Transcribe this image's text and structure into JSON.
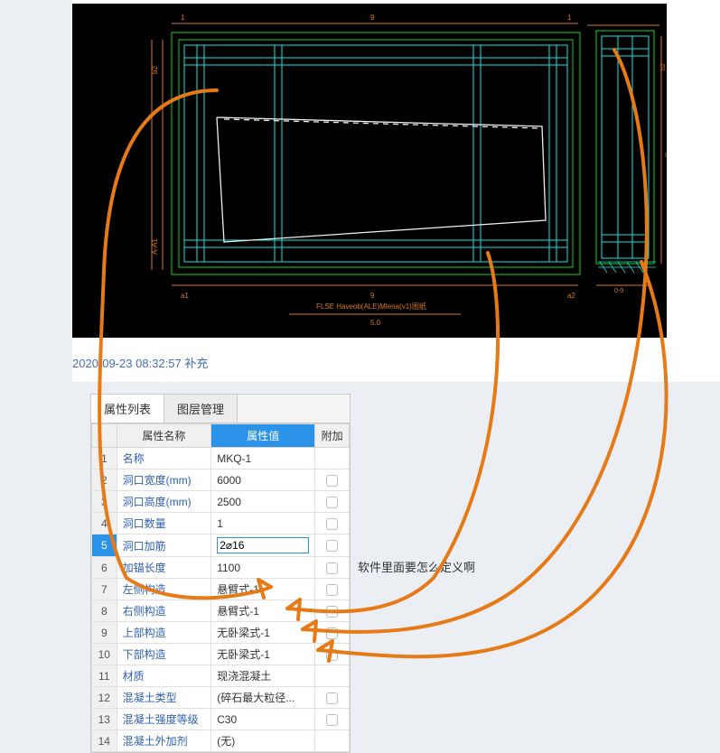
{
  "timestamp_line": "2020-09-23 08:32:57 补充",
  "tabs": {
    "active": "属性列表",
    "inactive": "图层管理"
  },
  "headers": {
    "name": "属性名称",
    "value": "属性值",
    "extra": "附加"
  },
  "side_note": "软件里面要怎么定义啊",
  "rows": [
    {
      "n": "1",
      "name": "名称",
      "val": "MKQ-1",
      "link": true,
      "chk": false
    },
    {
      "n": "2",
      "name": "洞口宽度(mm)",
      "val": "6000",
      "link": true,
      "chk": true
    },
    {
      "n": "3",
      "name": "洞口高度(mm)",
      "val": "2500",
      "link": true,
      "chk": true
    },
    {
      "n": "4",
      "name": "洞口数量",
      "val": "1",
      "link": true,
      "chk": true
    },
    {
      "n": "5",
      "name": "洞口加筋",
      "val": "2⌀16",
      "link": true,
      "chk": true,
      "editing": true,
      "selected": true
    },
    {
      "n": "6",
      "name": "加锚长度",
      "val": "1100",
      "link": true,
      "chk": true
    },
    {
      "n": "7",
      "name": "左侧构造",
      "val": "悬臂式-1",
      "link": true,
      "chk": true
    },
    {
      "n": "8",
      "name": "右侧构造",
      "val": "悬臂式-1",
      "link": true,
      "chk": true
    },
    {
      "n": "9",
      "name": "上部构造",
      "val": "无卧梁式-1",
      "link": true,
      "chk": true
    },
    {
      "n": "10",
      "name": "下部构造",
      "val": "无卧梁式-1",
      "link": true,
      "chk": true
    },
    {
      "n": "11",
      "name": "材质",
      "val": "现浇混凝土",
      "link": true,
      "chk": false
    },
    {
      "n": "12",
      "name": "混凝土类型",
      "val": "(碎石最大粒径...",
      "link": true,
      "chk": true
    },
    {
      "n": "13",
      "name": "混凝土强度等级",
      "val": "C30",
      "link": true,
      "chk": true
    },
    {
      "n": "14",
      "name": "混凝土外加剂",
      "val": "(无)",
      "link": true,
      "chk": false
    }
  ],
  "cad": {
    "title_below": "FLSE Haveob(ALE)Mlena(v1)图纸",
    "scale_label": "5.0",
    "dims_top": [
      "1",
      "9",
      "1"
    ],
    "dims_bottom": [
      "a1",
      "9",
      "a2"
    ],
    "right_section_label": "0-9"
  }
}
